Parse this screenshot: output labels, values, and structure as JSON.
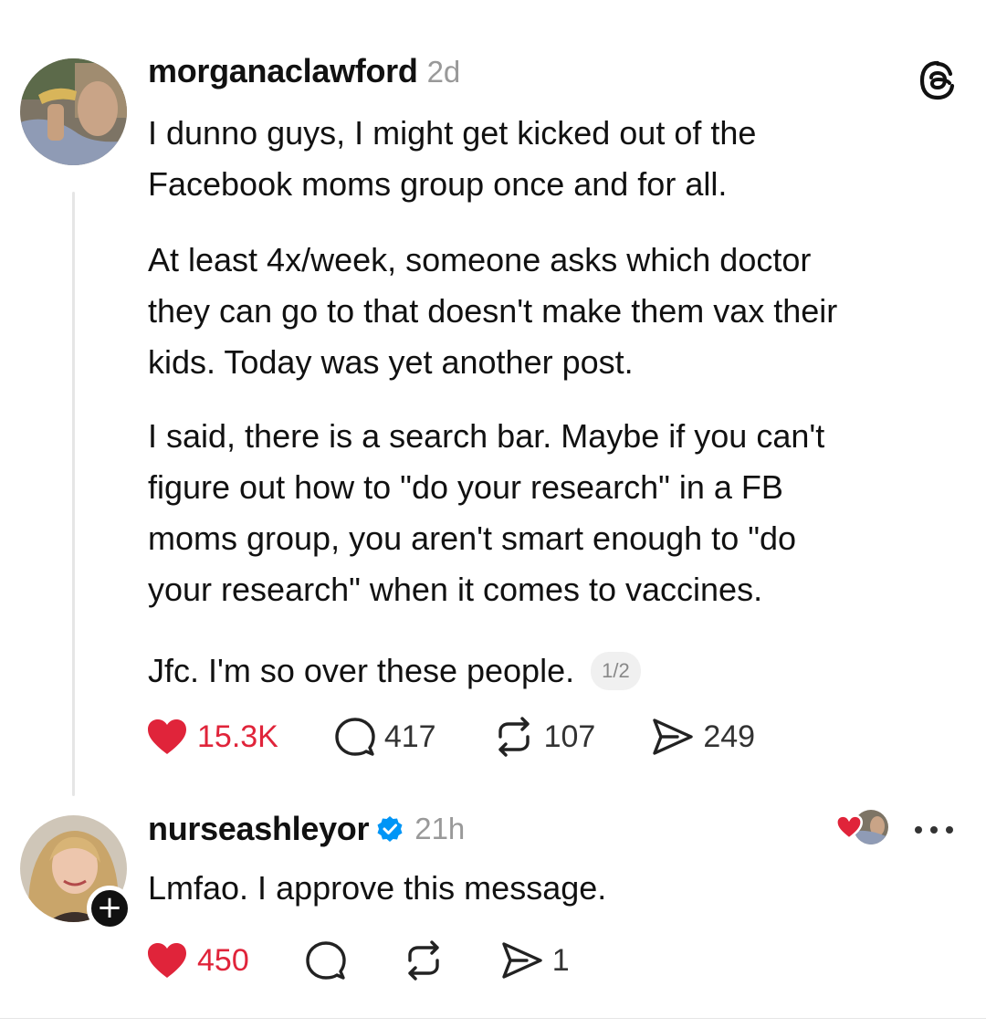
{
  "post": {
    "username": "morganaclawford",
    "time": "2d",
    "paragraphs": [
      [
        "I dunno guys, I might get kicked out of the",
        "Facebook moms group once and for all."
      ],
      [
        "At least 4x/week, someone asks which doctor",
        "they can go to that doesn't make them vax their",
        "kids. Today was yet another post."
      ],
      [
        "I said, there is a search bar. Maybe if you can't",
        "figure out how to \"do your research\" in a FB",
        "moms group, you aren't smart enough to \"do",
        "your research\" when it comes to vaccines."
      ],
      [
        "Jfc. I'm so over these people."
      ]
    ],
    "page_indicator": "1/2",
    "stats": {
      "likes": "15.3K",
      "replies": "417",
      "reposts": "107",
      "shares": "249"
    }
  },
  "reply": {
    "username": "nurseashleyor",
    "time": "21h",
    "text": "Lmfao. I approve this message.",
    "stats": {
      "likes": "450",
      "shares": "1"
    },
    "follow_symbol": "+"
  },
  "icons": {
    "logo": "threads-logo-icon",
    "like": "heart-filled-icon",
    "reply": "speech-bubble-icon",
    "repost": "repost-arrows-icon",
    "share": "send-arrow-icon",
    "verified": "verified-badge-icon",
    "more": "more-dots-icon"
  },
  "colors": {
    "like_red": "#e0243a",
    "verified_blue": "#0095f6",
    "muted_gray": "#999999",
    "text": "#111111"
  }
}
